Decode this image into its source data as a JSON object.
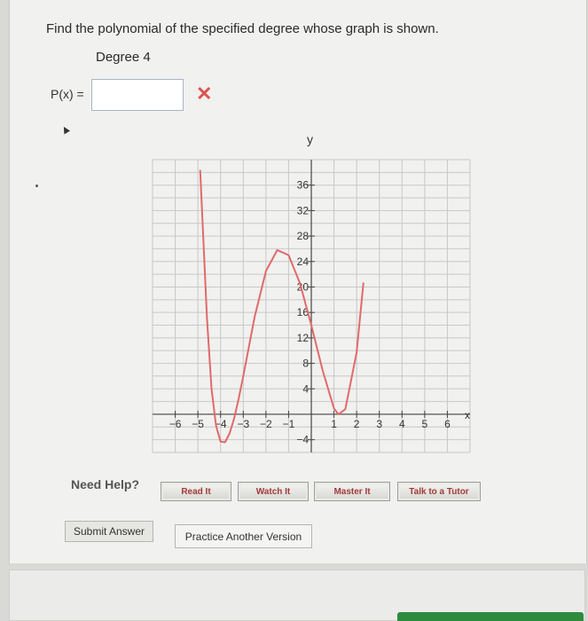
{
  "question": {
    "prompt": "Find the polynomial of the specified degree whose graph is shown.",
    "degree_label": "Degree 4",
    "answer_label": "P(x) =",
    "answer_value": "",
    "status_mark": "✕"
  },
  "chart_data": {
    "type": "line",
    "xlabel": "x",
    "ylabel": "y",
    "xlim": [
      -7,
      7
    ],
    "ylim": [
      -6,
      40
    ],
    "x_ticks": [
      -6,
      -5,
      -4,
      -3,
      -2,
      -1,
      1,
      2,
      3,
      4,
      5,
      6
    ],
    "x_tick_labels": [
      "−6",
      "−5",
      "−4",
      "−3",
      "−2",
      "−1",
      "1",
      "2",
      "3",
      "4",
      "5",
      "6"
    ],
    "y_ticks": [
      -4,
      4,
      8,
      12,
      16,
      20,
      24,
      28,
      32,
      36
    ],
    "y_tick_labels": [
      "−4",
      "4",
      "8",
      "12",
      "16",
      "20",
      "24",
      "28",
      "32",
      "36"
    ],
    "grid": true,
    "series": [
      {
        "color": "#e06a6a",
        "x": [
          -4.9,
          -4.6,
          -4.4,
          -4.2,
          -4.0,
          -3.8,
          -3.6,
          -3.4,
          -3.2,
          -3.0,
          -2.5,
          -2.0,
          -1.5,
          -1.0,
          -0.5,
          0,
          0.5,
          1.0,
          1.2,
          1.5,
          2.0,
          2.3
        ],
        "y": [
          38.4,
          15.0,
          4.0,
          -1.8,
          -4.3,
          -4.4,
          -3.0,
          -0.6,
          2.5,
          6.0,
          15.3,
          22.5,
          25.8,
          25.0,
          20.6,
          14.0,
          6.9,
          0.9,
          0.0,
          0.8,
          9.7,
          20.7
        ]
      }
    ]
  },
  "help": {
    "label": "Need Help?",
    "read_it": "Read It",
    "watch_it": "Watch It",
    "master_it": "Master It",
    "talk_to_tutor": "Talk to a Tutor"
  },
  "actions": {
    "submit": "Submit Answer",
    "practice": "Practice Another Version"
  }
}
